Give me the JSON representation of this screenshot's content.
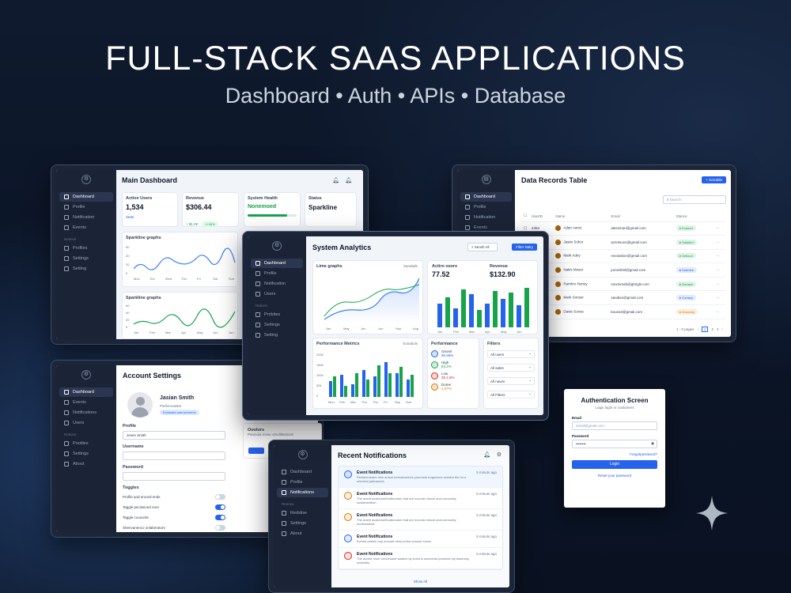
{
  "hero": {
    "title": "FULL-STACK SAAS APPLICATIONS",
    "subtitle": "Dashboard • Auth • APIs • Database"
  },
  "dash": {
    "title": "Main Dashboard",
    "nav": [
      "Dashboard",
      "Profile",
      "Notification",
      "Events"
    ],
    "section": "Notions",
    "nav2": [
      "Profiles",
      "Settings",
      "Setting"
    ],
    "stats": [
      {
        "label": "Active Users",
        "value": "1,534",
        "note": "Stats"
      },
      {
        "label": "Revenue",
        "value": "$306.44",
        "note": "+ $1.0K",
        "badge": "-0.55%"
      },
      {
        "label": "System Health",
        "value": "Nonemoed"
      },
      {
        "label": "Status",
        "value": "Sparkline"
      }
    ],
    "chart1": {
      "title": "Sparkline graphs",
      "x": [
        "Mon",
        "Tue",
        "Wed",
        "Thu",
        "Fri",
        "Sat",
        "Sun"
      ],
      "y": [
        "60",
        "40",
        "20",
        "0"
      ]
    },
    "chart2": {
      "title": "Sparkline graphs",
      "x": [
        "Jan",
        "Feb",
        "Mar",
        "Apr",
        "May",
        "Jun",
        "Jun"
      ],
      "y": [
        "60",
        "40",
        "20",
        "0"
      ]
    }
  },
  "table": {
    "title": "Data Records Table",
    "button": "+ Sorrable",
    "search": "Search",
    "nav": [
      "Dashboard",
      "Profile",
      "Notification",
      "Events"
    ],
    "headers": [
      "UserID",
      "Name",
      "Email",
      "Stance"
    ],
    "rows": [
      {
        "id": "4363",
        "name": "Adan Aams",
        "email": "alessman@gmail.com",
        "status": "Expired",
        "color": "#16a34a"
      },
      {
        "id": "3",
        "name": "Jastin Sohor",
        "email": "azsntsons@gmail.com",
        "status": "Satisfed",
        "color": "#16a34a"
      },
      {
        "id": "3",
        "name": "Mark Adey",
        "email": "nnxxtation@gmail.com",
        "status": "Setiood",
        "color": "#16a34a"
      },
      {
        "id": "5",
        "name": "Nakis Moser",
        "email": "jomsnibsl@gmail.com",
        "status": "Sotedes",
        "color": "#2563eb"
      },
      {
        "id": "6",
        "name": "Ramhro Noney",
        "email": "smxtomah@gtmgls.com",
        "status": "Dartace",
        "color": "#16a34a"
      },
      {
        "id": "3",
        "name": "Mark Sonser",
        "email": "sandien@gmail.com",
        "status": "Cortacy",
        "color": "#2563eb"
      },
      {
        "id": "2",
        "name": "Davie Sonse",
        "email": "kourxi2@gmail.com",
        "status": "Goscony",
        "color": "#d97706"
      }
    ],
    "pager": "1 - 0 pages",
    "pages": [
      "1",
      "2",
      "3"
    ]
  },
  "analytics": {
    "title": "System Analytics",
    "search": "Seosh All",
    "filter": "Filter Nalry",
    "nav": [
      "Dashboard",
      "Profile",
      "Notification",
      "Users"
    ],
    "section": "Nations",
    "nav2": [
      "Probites",
      "Settings",
      "Setting"
    ],
    "line": {
      "title": "Lime graphs",
      "select": "Sandade",
      "x": [
        "Jan",
        "May",
        "Jun",
        "Jun",
        "Sep",
        "Aug"
      ]
    },
    "users": {
      "label": "Actiro osers",
      "value": "77.52"
    },
    "revenue": {
      "label": "Revenue",
      "value": "$132.90"
    },
    "bars_x": [
      "Jan",
      "Feb",
      "Mar",
      "Apr",
      "May",
      "Jun"
    ],
    "perf": {
      "title": "Performance Metrics",
      "select": "Sonabols",
      "y": [
        "200k",
        "150k",
        "100k",
        "50k",
        "0"
      ],
      "x": [
        "Mon",
        "Feb",
        "Mar",
        "Thu",
        "Thu",
        "Fri",
        "Sep",
        "Sun"
      ]
    },
    "kpis": {
      "title": "Performance",
      "items": [
        {
          "name": "Geoml",
          "val": "86.66%",
          "color": "#2563eb"
        },
        {
          "name": "High",
          "val": "83.2%",
          "color": "#16a34a"
        },
        {
          "name": "Low",
          "val": "39.1.8%",
          "color": "#dc2626"
        },
        {
          "name": "Dome",
          "val": "4.07%",
          "color": "#d97706"
        }
      ]
    },
    "filters": {
      "title": "Filters",
      "items": [
        "All users",
        "All sales",
        "All naves",
        "All Filters"
      ]
    }
  },
  "account": {
    "title": "Account Settings",
    "nav": [
      "Dashboard",
      "Events",
      "Notifications",
      "Users"
    ],
    "section": "Notions",
    "nav2": [
      "Pootiles",
      "Settings",
      "About"
    ],
    "name": "Jasian Smith",
    "role": "Pieifomoaster",
    "badge": "Ersiasaia aneusoments",
    "f_profile": "Profile",
    "f_profile_val": "Jesen Smith",
    "f_user": "Username",
    "f_pass": "Password",
    "toggles_title": "Toggles",
    "toggles": [
      "Profile and encord ends",
      "Taggle pecissiond nore",
      "Taggle coosords",
      "Shenvanenco onlaberators"
    ],
    "side_title": "Ooolors",
    "side_sub": "Paniouia mose omulitlastions"
  },
  "notif": {
    "title": "Recent Notifications",
    "nav": [
      "Dashboard",
      "Profile",
      "Notifications"
    ],
    "section": "Reones",
    "nav2": [
      "Redslise",
      "Settings",
      "About"
    ],
    "items": [
      {
        "title": "Event Notifications",
        "body": "Redsiinmeane new arosnt keesdusekcts yourmsrs bogsosutv seestra the ho e orientral palicasnds.",
        "time": "5 minuts ago",
        "color": "#2563eb"
      },
      {
        "title": "Event Notifications",
        "body": "The anerit avald-eselhudtorsdon that are eccurdz dstom and comrootty sustainsettion.",
        "time": "5 minuts ago",
        "color": "#d97706"
      },
      {
        "title": "Event Notifications",
        "body": "The anerit avald-eselhudtorsdon that are eccurdz dstom and comrootty ecutionsdcal.",
        "time": "5 minuts ago",
        "color": "#d97706"
      },
      {
        "title": "Event Notifications",
        "body": "Events eebele any eoroset eresi prnsd eessoe evens.",
        "time": "5 minuts ago",
        "color": "#2563eb"
      },
      {
        "title": "Event Notifications",
        "body": "The aurerit more ores'esaret sadled my eveis'is sncments presents my bsseresy omisetbe.",
        "time": "5 minuts ago",
        "color": "#dc2626"
      }
    ],
    "show_all": "Show All"
  },
  "auth": {
    "title": "Authentication Screen",
    "sub": "Login login or customers",
    "email_label": "Email",
    "email_placeholder": "email@gmail.com",
    "pass_label": "Password",
    "pass_value": "••••••••",
    "forgot": "Forgotpassword?",
    "login": "Login",
    "reset": "Reset your password"
  }
}
